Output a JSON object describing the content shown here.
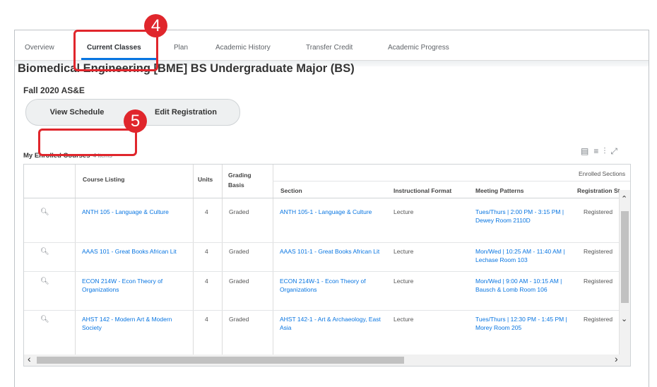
{
  "tabs": [
    {
      "label": "Overview",
      "active": false
    },
    {
      "label": "Current Classes",
      "active": true
    },
    {
      "label": "Plan",
      "active": false
    },
    {
      "label": "Academic History",
      "active": false
    },
    {
      "label": "Transfer Credit",
      "active": false
    },
    {
      "label": "Academic Progress",
      "active": false
    }
  ],
  "callouts": {
    "step1": "4",
    "step2": "5",
    "color": "#e0262c"
  },
  "page": {
    "title": "Biomedical Engineering [BME] BS Undergraduate Major (BS)",
    "term": "Fall 2020 AS&E"
  },
  "buttons": {
    "view_schedule": "View Schedule",
    "edit_registration": "Edit Registration"
  },
  "table": {
    "title": "My Enrolled Courses",
    "count": "4 items",
    "group_header": "Enrolled Sections",
    "headers": {
      "course_listing": "Course Listing",
      "units": "Units",
      "grading_basis": "Grading Basis",
      "section": "Section",
      "instructional_format": "Instructional Format",
      "meeting_patterns": "Meeting Patterns",
      "registration_status": "Registration St"
    },
    "rows": [
      {
        "course": "ANTH 105 - Language & Culture",
        "units": "4",
        "grading": "Graded",
        "section": "ANTH 105-1 - Language & Culture",
        "format": "Lecture",
        "meeting": "Tues/Thurs | 2:00 PM - 3:15 PM | Dewey Room 2110D",
        "status": "Registered"
      },
      {
        "course": "AAAS 101 - Great Books African Lit",
        "units": "4",
        "grading": "Graded",
        "section": "AAAS 101-1 - Great Books African Lit",
        "format": "Lecture",
        "meeting": "Mon/Wed | 10:25 AM - 11:40 AM | Lechase Room 103",
        "status": "Registered"
      },
      {
        "course": "ECON 214W - Econ Theory of Organizations",
        "units": "4",
        "grading": "Graded",
        "section": "ECON 214W-1 - Econ Theory of Organizations",
        "format": "Lecture",
        "meeting": "Mon/Wed | 9:00 AM - 10:15 AM | Bausch & Lomb Room 106",
        "status": "Registered"
      },
      {
        "course": "AHST 142 - Modern Art & Modern Society",
        "units": "4",
        "grading": "Graded",
        "section": "AHST 142-1 - Art & Archaeology, East Asia",
        "format": "Lecture",
        "meeting": "Tues/Thurs | 12:30 PM - 1:45 PM | Morey Room 205",
        "status": "Registered"
      }
    ]
  },
  "colors": {
    "accent": "#0875e1",
    "callout": "#e0262c"
  }
}
